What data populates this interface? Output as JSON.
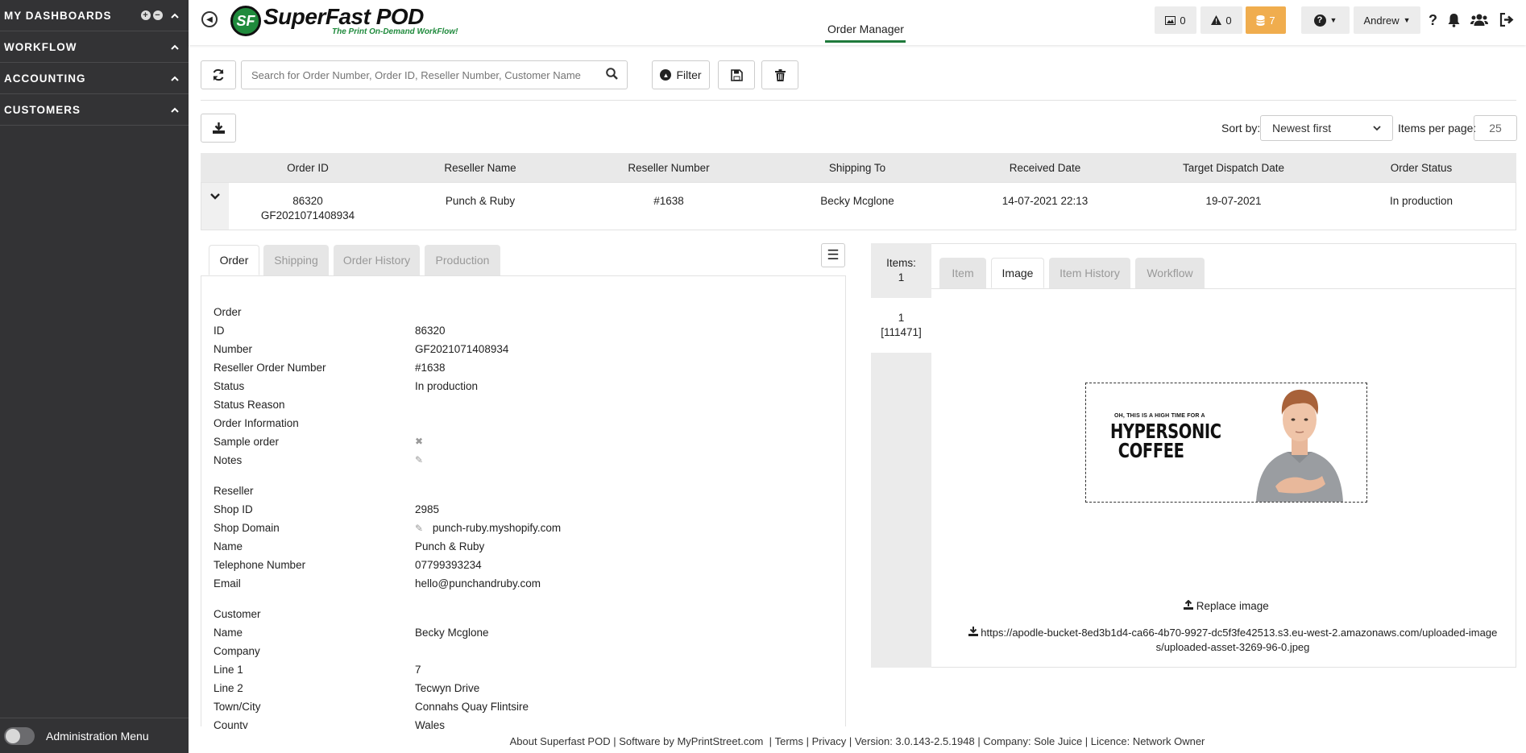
{
  "sidebar": {
    "items": [
      {
        "label": "MY DASHBOARDS"
      },
      {
        "label": "WORKFLOW"
      },
      {
        "label": "ACCOUNTING"
      },
      {
        "label": "CUSTOMERS"
      }
    ],
    "admin_label": "Administration Menu"
  },
  "header": {
    "logo_badge": "SF",
    "logo_title": "SuperFast POD",
    "logo_tagline": "The Print On-Demand WorkFlow!",
    "page_title": "Order Manager",
    "images_count": "0",
    "warnings_count": "0",
    "queue_count": "7",
    "user": "Andrew"
  },
  "toolbar": {
    "search_placeholder": "Search for Order Number, Order ID, Reseller Number, Customer Name",
    "filter_label": "Filter",
    "sort_label": "Sort by:",
    "sort_value": "Newest first",
    "ipp_label": "Items per page:",
    "ipp_value": "25"
  },
  "table": {
    "headers": [
      "Order ID",
      "Reseller Name",
      "Reseller Number",
      "Shipping To",
      "Received Date",
      "Target Dispatch Date",
      "Order Status"
    ],
    "row": {
      "order_id": "86320",
      "order_number": "GF2021071408934",
      "reseller_name": "Punch & Ruby",
      "reseller_number": "#1638",
      "shipping_to": "Becky Mcglone",
      "received": "14-07-2021 22:13",
      "dispatch": "19-07-2021",
      "status": "In production"
    }
  },
  "left_tabs": [
    "Order",
    "Shipping",
    "Order History",
    "Production"
  ],
  "order_details": {
    "order_title": "Order",
    "order_fields": [
      {
        "label": "ID",
        "value": "86320"
      },
      {
        "label": "Number",
        "value": "GF2021071408934"
      },
      {
        "label": "Reseller Order Number",
        "value": "#1638"
      },
      {
        "label": "Status",
        "value": "In production"
      },
      {
        "label": "Status Reason",
        "value": ""
      },
      {
        "label": "Order Information",
        "value": ""
      },
      {
        "label": "Sample order",
        "value": ""
      },
      {
        "label": "Notes",
        "value": ""
      }
    ],
    "reseller_title": "Reseller",
    "reseller_fields": [
      {
        "label": "Shop ID",
        "value": "2985"
      },
      {
        "label": "Shop Domain",
        "value": "punch-ruby.myshopify.com"
      },
      {
        "label": "Name",
        "value": "Punch & Ruby"
      },
      {
        "label": "Telephone Number",
        "value": "07799393234"
      },
      {
        "label": "Email",
        "value": "hello@punchandruby.com"
      }
    ],
    "customer_title": "Customer",
    "customer_fields": [
      {
        "label": "Name",
        "value": "Becky Mcglone"
      },
      {
        "label": "Company",
        "value": ""
      },
      {
        "label": "Line 1",
        "value": "7"
      },
      {
        "label": "Line 2",
        "value": "Tecwyn Drive"
      },
      {
        "label": "Town/City",
        "value": "Connahs Quay Flintsire"
      },
      {
        "label": "County",
        "value": "Wales"
      }
    ]
  },
  "items": {
    "count_label": "Items:",
    "count": "1",
    "entry_index": "1",
    "entry_id": "[111471]"
  },
  "right_tabs": [
    "Item",
    "Image",
    "Item History",
    "Workflow"
  ],
  "image": {
    "design_small": "OH, THIS IS A HIGH TIME FOR A",
    "design_line1": "HYPERSONIC",
    "design_line2": "COFFEE",
    "replace_label": "Replace image",
    "url": "https://apodle-bucket-8ed3b1d4-ca66-4b70-9927-dc5f3fe42513.s3.eu-west-2.amazonaws.com/uploaded-images/uploaded-asset-3269-96-0.jpeg"
  },
  "footer": {
    "about": "About Superfast POD",
    "software": "Software by MyPrintStreet.com",
    "terms": "Terms",
    "privacy": "Privacy",
    "version": "Version: 3.0.143-2.5.1948",
    "company": "Company: Sole Juice",
    "licence": "Licence: Network Owner"
  },
  "colors": {
    "sidebar_bg": "#333335",
    "brand_green": "#1f8a3c",
    "queue_orange": "#f0ad4e"
  }
}
